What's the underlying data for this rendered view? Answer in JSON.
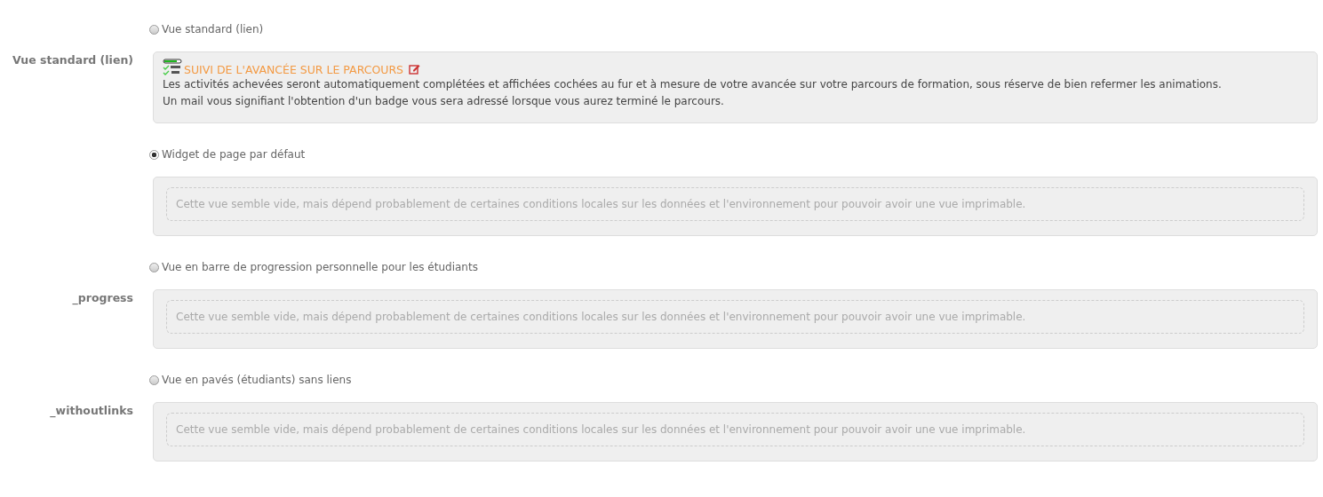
{
  "views": [
    {
      "option": {
        "label": "Vue standard (lien)",
        "selected": false
      },
      "label": "Vue standard (lien)",
      "panel": {
        "kind": "content",
        "title": "SUIVI DE L'AVANCÉE SUR LE PARCOURS",
        "paragraphs": [
          "Les activités achevées seront automatiquement complétées et affichées cochées au fur et à mesure de votre avancée sur votre parcours de formation, sous réserve de bien refermer les animations.",
          "Un mail vous signifiant l'obtention d'un badge vous sera adressé lorsque vous aurez terminé le parcours."
        ]
      }
    },
    {
      "option": {
        "label": "Widget de page par défaut",
        "selected": true
      },
      "panel": {
        "kind": "empty",
        "message": "Cette vue semble vide, mais dépend probablement de certaines conditions locales sur les données et l'environnement pour pouvoir avoir une vue imprimable."
      }
    },
    {
      "option": {
        "label": "Vue en barre de progression personnelle pour les étudiants",
        "selected": false
      },
      "label": "_progress",
      "panel": {
        "kind": "empty",
        "message": "Cette vue semble vide, mais dépend probablement de certaines conditions locales sur les données et l'environnement pour pouvoir avoir une vue imprimable."
      }
    },
    {
      "option": {
        "label": "Vue en pavés (étudiants) sans liens",
        "selected": false
      },
      "label": "_withoutlinks",
      "panel": {
        "kind": "empty",
        "message": "Cette vue semble vide, mais dépend probablement de certaines conditions locales sur les données et l'environnement pour pouvoir avoir une vue imprimable."
      }
    }
  ]
}
